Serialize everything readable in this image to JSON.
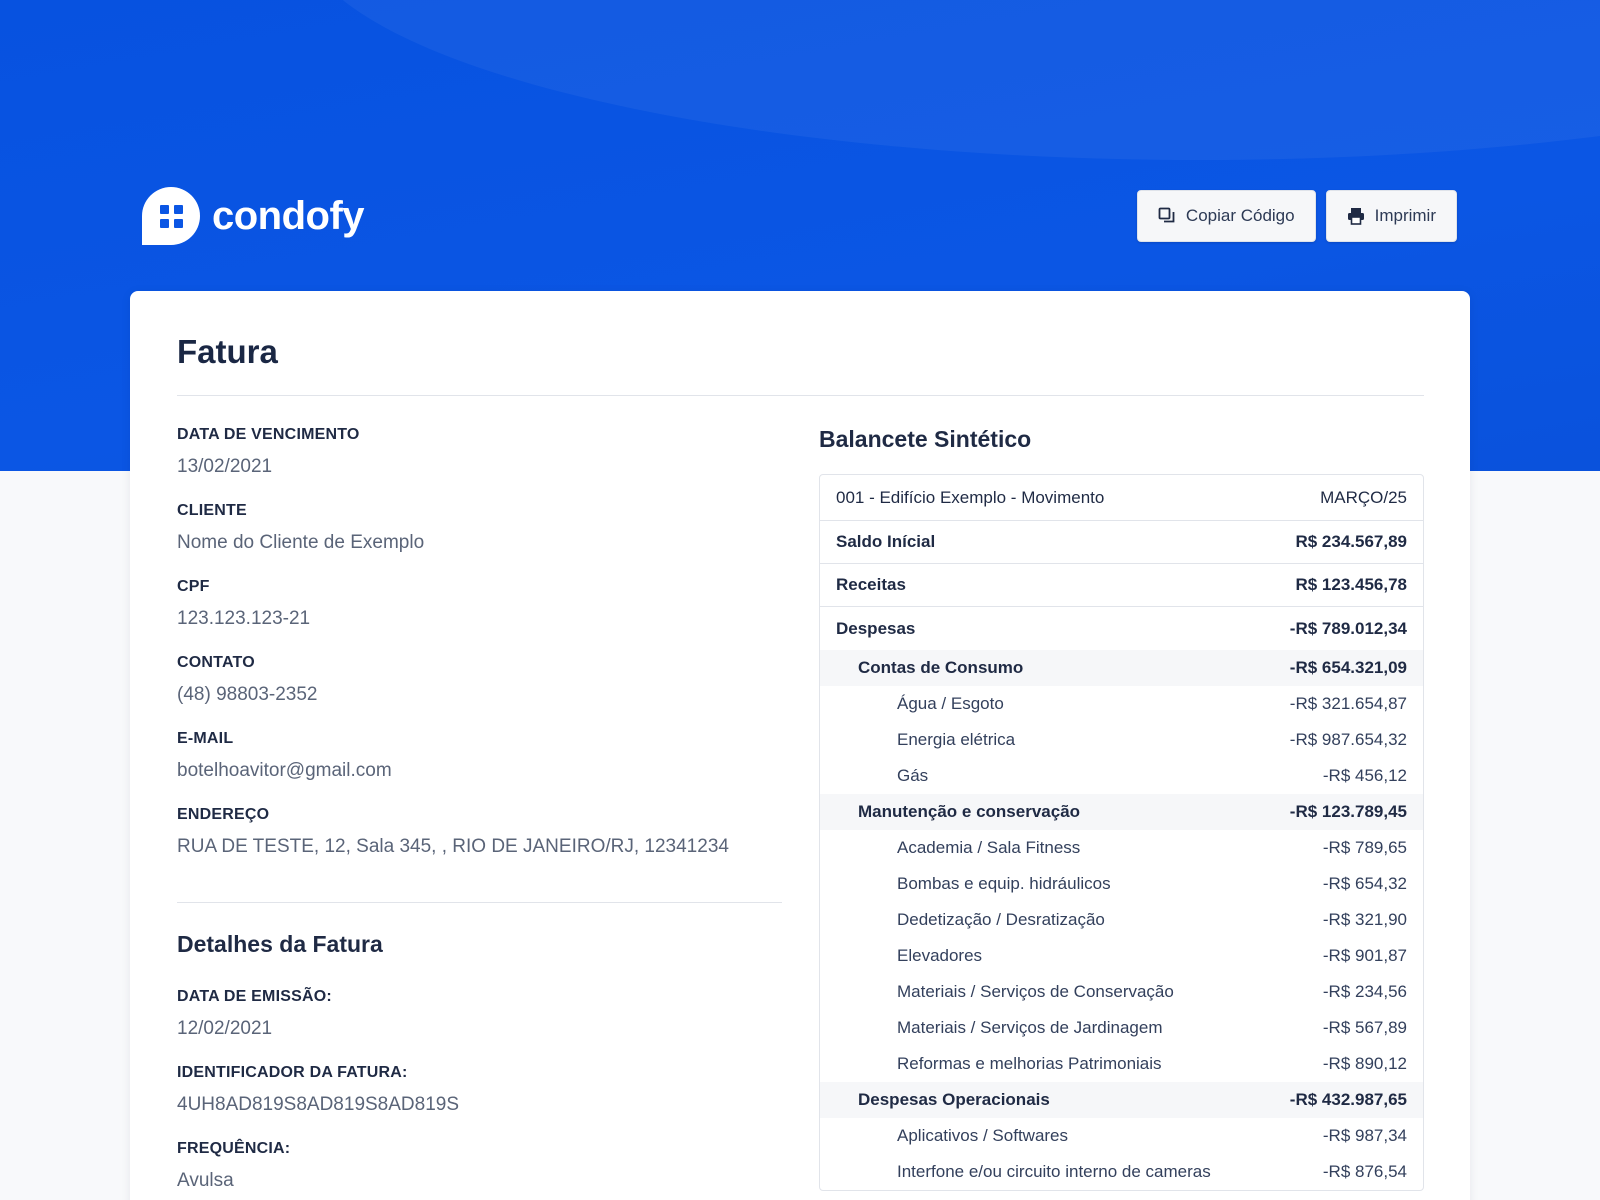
{
  "brand": {
    "name": "condofy"
  },
  "actions": {
    "copy_label": "Copiar Código",
    "print_label": "Imprimir"
  },
  "invoice": {
    "title": "Fatura",
    "fields": [
      {
        "label": "DATA DE VENCIMENTO",
        "value": "13/02/2021"
      },
      {
        "label": "CLIENTE",
        "value": "Nome do Cliente de Exemplo"
      },
      {
        "label": "CPF",
        "value": "123.123.123-21"
      },
      {
        "label": "CONTATO",
        "value": "(48) 98803-2352"
      },
      {
        "label": "E-MAIL",
        "value": "botelhoavitor@gmail.com"
      },
      {
        "label": "ENDEREÇO",
        "value": "RUA DE TESTE, 12, Sala 345, , RIO DE JANEIRO/RJ, 12341234"
      }
    ],
    "details": {
      "title": "Detalhes da Fatura",
      "fields": [
        {
          "label": "DATA DE EMISSÃO:",
          "value": "12/02/2021"
        },
        {
          "label": "IDENTIFICADOR DA FATURA:",
          "value": "4UH8AD819S8AD819S8AD819S"
        },
        {
          "label": "FREQUÊNCIA:",
          "value": "Avulsa"
        }
      ]
    }
  },
  "balance": {
    "title": "Balancete Sintético",
    "header": {
      "account": "001 - Edifício Exemplo - Movimento",
      "period": "MARÇO/25"
    },
    "saldo": {
      "label": "Saldo Inícial",
      "value": "R$ 234.567,89"
    },
    "receitas": {
      "label": "Receitas",
      "value": "R$ 123.456,78"
    },
    "despesas": {
      "label": "Despesas",
      "value": "-R$ 789.012,34"
    },
    "groups": [
      {
        "label": "Contas de Consumo",
        "value": "-R$ 654.321,09",
        "items": [
          {
            "label": "Água / Esgoto",
            "value": "-R$ 321.654,87"
          },
          {
            "label": "Energia elétrica",
            "value": "-R$ 987.654,32"
          },
          {
            "label": "Gás",
            "value": "-R$ 456,12"
          }
        ]
      },
      {
        "label": "Manutenção e conservação",
        "value": "-R$ 123.789,45",
        "items": [
          {
            "label": "Academia / Sala Fitness",
            "value": "-R$ 789,65"
          },
          {
            "label": "Bombas e equip. hidráulicos",
            "value": "-R$ 654,32"
          },
          {
            "label": "Dedetização / Desratização",
            "value": "-R$ 321,90"
          },
          {
            "label": "Elevadores",
            "value": "-R$ 901,87"
          },
          {
            "label": "Materiais / Serviços de Conservação",
            "value": "-R$ 234,56"
          },
          {
            "label": "Materiais / Serviços de Jardinagem",
            "value": "-R$ 567,89"
          },
          {
            "label": "Reformas e melhorias Patrimoniais",
            "value": "-R$ 890,12"
          }
        ]
      },
      {
        "label": "Despesas Operacionais",
        "value": "-R$ 432.987,65",
        "items": [
          {
            "label": "Aplicativos / Softwares",
            "value": "-R$ 987,34"
          },
          {
            "label": "Interfone e/ou circuito interno de cameras",
            "value": "-R$ 876,54"
          }
        ]
      }
    ]
  },
  "colors": {
    "primary": "#0b56e4",
    "text": "#1f2a44",
    "muted": "#5a6478"
  }
}
